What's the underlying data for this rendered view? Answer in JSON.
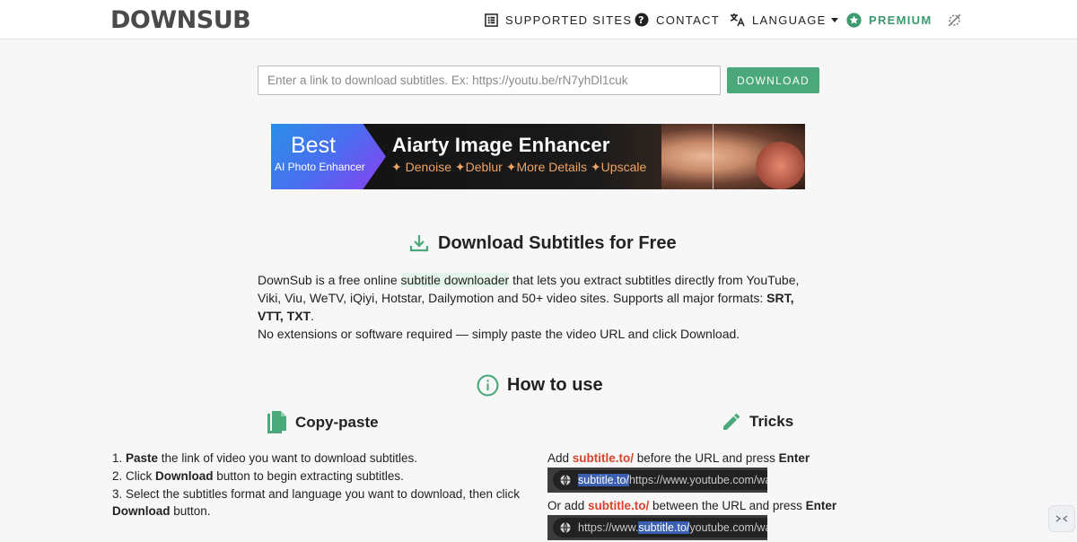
{
  "header": {
    "logo": "DOWNSUB",
    "nav": {
      "supported_sites": "SUPPORTED SITES",
      "contact": "CONTACT",
      "language": "LANGUAGE",
      "premium": "PREMIUM"
    }
  },
  "search": {
    "placeholder": "Enter a link to download subtitles. Ex: https://youtu.be/rN7yhDl1cuk",
    "value": "",
    "button_label": "DOWNLOAD"
  },
  "banner": {
    "best": "Best",
    "sub": "AI Photo Enhancer",
    "title": "Aiarty Image Enhancer",
    "features": "✦ Denoise ✦Deblur ✦More Details ✦Upscale"
  },
  "intro": {
    "title": "Download Subtitles for Free",
    "p1_prefix": "DownSub is a free online ",
    "p1_link": "subtitle downloader",
    "p1_middle": " that lets you extract subtitles directly from YouTube, Viki, Viu, WeTV, iQiyi, Hotstar, Dailymotion and 50+ video sites. Supports all major formats: ",
    "p1_formats": "SRT, VTT, TXT",
    "p1_suffix": ".",
    "p2": "No extensions or software required — simply paste the video URL and click Download."
  },
  "how": {
    "title": "How to use",
    "copy_title": "Copy-paste",
    "tricks_title": "Tricks",
    "steps": [
      {
        "num": "1. ",
        "bold": "Paste",
        "rest": " the link of video you want to download subtitles."
      },
      {
        "num": "2. ",
        "pre": "Click ",
        "bold": "Download",
        "rest": " button to begin extracting subtitles."
      },
      {
        "num": "3. ",
        "pre": "Select the subtitles format and language you want to download, then click ",
        "bold": "Download",
        "rest": " button."
      }
    ],
    "trick1": {
      "pre": "Add ",
      "red": "subtitle.to/",
      "mid": " before the URL and press ",
      "bold": "Enter"
    },
    "trick2": {
      "pre": "Or add ",
      "red": "subtitle.to/",
      "mid": " between the URL and press ",
      "bold": "Enter"
    },
    "url1": {
      "sel": "subtitle.to/",
      "rest": "https://www.youtube.com/watch?v="
    },
    "url2": {
      "pre": "https://www.",
      "sel": "subtitle.to/",
      "rest": "youtube.com/watch?v="
    }
  },
  "colors": {
    "accent": "#4aa87a",
    "highlight_red": "#d9452c",
    "premium_green": "#3d9a6e"
  },
  "icons": [
    "list-icon",
    "help-circle-icon",
    "translate-icon",
    "star-badge-icon",
    "theme-toggle-icon",
    "download-icon",
    "info-icon",
    "copy-icon",
    "pencil-icon",
    "globe-icon"
  ]
}
